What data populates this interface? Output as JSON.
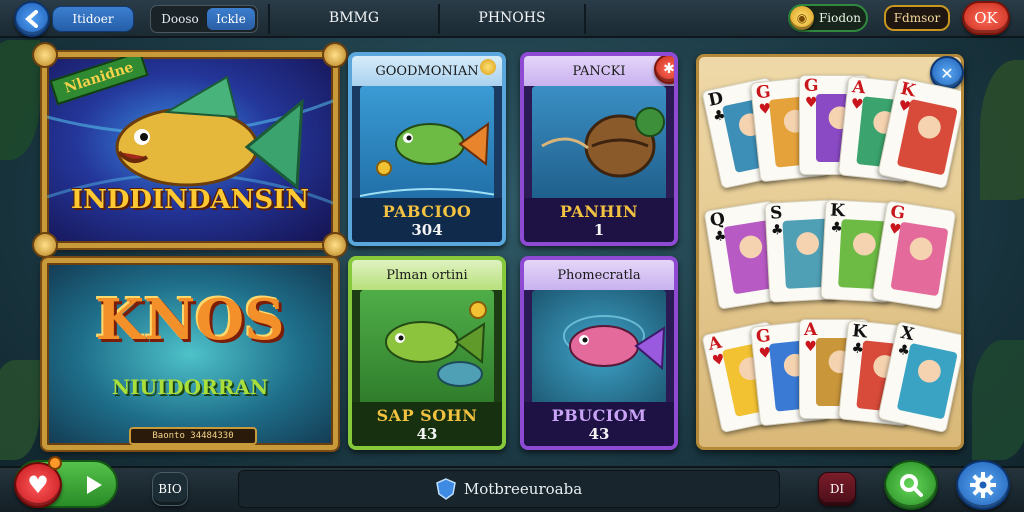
{
  "top_bar": {
    "back_label": "Itidoer",
    "toggle_left": "Dooso",
    "toggle_right": "Ickle",
    "tab_games": "BMMG",
    "tab_phones": "PHNOHS",
    "coins_label": "Fiodon",
    "extra_label": "Fdmsor",
    "ok_label": "OK"
  },
  "banners": {
    "top": {
      "tag": "Nlanidne",
      "title": "INDDINDANSIN"
    },
    "bottom": {
      "title_main": "KNOS",
      "title_sub": "NIUIDORRAN",
      "plate": "Baonto 34484330"
    }
  },
  "tiles": [
    {
      "header": "GOODMONIAN",
      "name": "PABCIOO",
      "number": "304"
    },
    {
      "header": "PANCKI",
      "name": "PANHIN",
      "number": "1"
    },
    {
      "header": "Plman ortini",
      "name": "SAP SOHN",
      "number": "43"
    },
    {
      "header": "Phomecratla",
      "name": "PBUCIOM",
      "number": "43"
    }
  ],
  "cards": [
    {
      "rank": "D",
      "suit": "♣",
      "red": false
    },
    {
      "rank": "G",
      "suit": "♥",
      "red": true
    },
    {
      "rank": "G",
      "suit": "♥",
      "red": true
    },
    {
      "rank": "A",
      "suit": "♥",
      "red": true
    },
    {
      "rank": "K",
      "suit": "♥",
      "red": true
    },
    {
      "rank": "Q",
      "suit": "♣",
      "red": false
    },
    {
      "rank": "S",
      "suit": "♣",
      "red": false
    },
    {
      "rank": "K",
      "suit": "♣",
      "red": false
    },
    {
      "rank": "G",
      "suit": "♥",
      "red": true
    },
    {
      "rank": "A",
      "suit": "♥",
      "red": true
    },
    {
      "rank": "G",
      "suit": "♥",
      "red": true
    },
    {
      "rank": "A",
      "suit": "♥",
      "red": true
    },
    {
      "rank": "K",
      "suit": "♣",
      "red": false
    },
    {
      "rank": "X",
      "suit": "♣",
      "red": false
    }
  ],
  "bottom_bar": {
    "bio_label": "BIO",
    "search_text": "Motbreeuroaba",
    "di_label": "DI"
  },
  "icons": {
    "back": "chevron-left-icon",
    "coin": "coin-icon",
    "close": "close-icon",
    "settings": "gear-icon",
    "search": "search-icon",
    "heart": "heart-icon",
    "play": "play-icon"
  }
}
